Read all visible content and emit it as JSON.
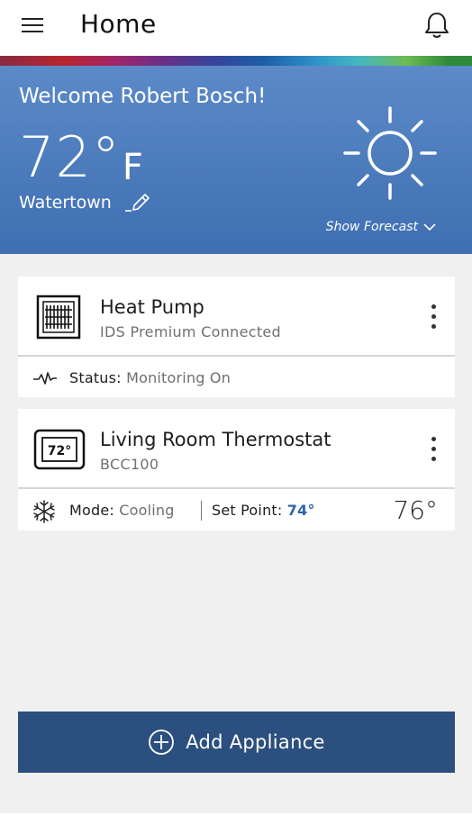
{
  "header": {
    "title": "Home",
    "menu_icon": "hamburger-menu-icon",
    "notification_icon": "bell-icon"
  },
  "colors": {
    "hero_top": "#5c8ac8",
    "hero_bottom": "#3f6fb2",
    "accent_blue": "#2c66a8",
    "add_button": "#2b4f7e"
  },
  "weather": {
    "greeting": "Welcome Robert Bosch!",
    "temperature": "72°",
    "unit": "F",
    "location": "Watertown",
    "condition_icon": "sun-icon",
    "forecast_label": "Show Forecast"
  },
  "devices": [
    {
      "name": "Heat Pump",
      "subtitle": "IDS Premium Connected",
      "icon": "heat-pump-icon",
      "status_label": "Status:",
      "status_value": "Monitoring On",
      "status_icon": "activity-pulse-icon"
    },
    {
      "name": "Living Room Thermostat",
      "subtitle": "BCC100",
      "icon": "thermostat-icon",
      "icon_text": "72°",
      "mode_label": "Mode:",
      "mode_value": "Cooling",
      "mode_icon": "snowflake-icon",
      "setpoint_label": "Set Point:",
      "setpoint_value": "74°",
      "current_temp": "76°"
    }
  ],
  "actions": {
    "add_appliance_label": "Add Appliance",
    "add_icon": "plus-circle-icon"
  }
}
